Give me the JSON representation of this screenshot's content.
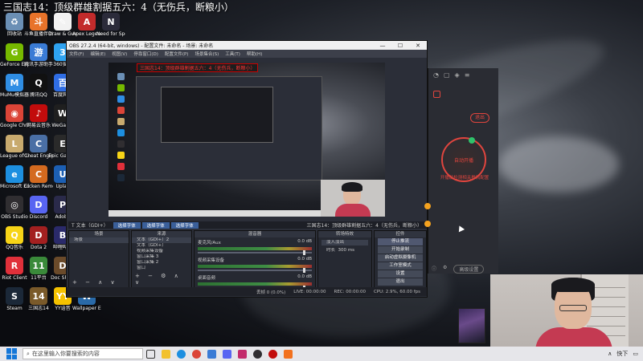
{
  "overlay_title": "三国志14：顶级群雄割据五六：4（无伤兵，断粮小）",
  "desktop_icons": [
    {
      "name": "recycle-bin-icon",
      "label": "回收站",
      "color": "#6b8fb5",
      "glyph": "♻",
      "col": 0,
      "row": 0
    },
    {
      "name": "game-launcher-icon",
      "label": "斗鱼直播伴侣",
      "color": "#e8732a",
      "glyph": "斗",
      "col": 1,
      "row": 0
    },
    {
      "name": "draw-guess-icon",
      "label": "Draw & Guess",
      "color": "#f2f2f2",
      "glyph": "✎",
      "col": 2,
      "row": 0
    },
    {
      "name": "apex-icon",
      "label": "Apex Legends",
      "color": "#c22b2b",
      "glyph": "A",
      "col": 3,
      "row": 0
    },
    {
      "name": "nfs-icon",
      "label": "Need for Speed™",
      "color": "#2b2b3a",
      "glyph": "N",
      "col": 4,
      "row": 0
    },
    {
      "name": "geforce-icon",
      "label": "GeForce Experience",
      "color": "#76b900",
      "glyph": "G",
      "col": 0,
      "row": 1
    },
    {
      "name": "tencent-game-icon",
      "label": "腾讯手游助手",
      "color": "#3a7bd5",
      "glyph": "游",
      "col": 1,
      "row": 1
    },
    {
      "name": "360-icon",
      "label": "360安全",
      "color": "#2ea3f2",
      "glyph": "3",
      "col": 2,
      "row": 1
    },
    {
      "name": "mumu-icon",
      "label": "MuMu模拟器",
      "color": "#2f8de4",
      "glyph": "M",
      "col": 0,
      "row": 2
    },
    {
      "name": "qq-icon",
      "label": "腾讯QQ",
      "color": "#111",
      "glyph": "Q",
      "col": 1,
      "row": 2
    },
    {
      "name": "baidu-icon",
      "label": "百度网盘",
      "color": "#2f6de4",
      "glyph": "百",
      "col": 2,
      "row": 2
    },
    {
      "name": "chrome-icon",
      "label": "Google Chrome",
      "color": "#db4437",
      "glyph": "◉",
      "col": 0,
      "row": 3
    },
    {
      "name": "netease-music-icon",
      "label": "网易云音乐",
      "color": "#c20c0c",
      "glyph": "♪",
      "col": 1,
      "row": 3
    },
    {
      "name": "wegame-icon",
      "label": "WeGame",
      "color": "#1f1f1f",
      "glyph": "W",
      "col": 2,
      "row": 3
    },
    {
      "name": "lol-icon",
      "label": "League of Legends",
      "color": "#c8aa6e",
      "glyph": "L",
      "col": 0,
      "row": 4
    },
    {
      "name": "cheat-engine-icon",
      "label": "Cheat Engine",
      "color": "#4a6fa5",
      "glyph": "C",
      "col": 1,
      "row": 4
    },
    {
      "name": "epic-icon",
      "label": "Epic Games",
      "color": "#2a2a2a",
      "glyph": "E",
      "col": 2,
      "row": 4
    },
    {
      "name": "edge-icon",
      "label": "Microsoft Edge",
      "color": "#1d8fe0",
      "glyph": "e",
      "col": 0,
      "row": 5
    },
    {
      "name": "cicken-icon",
      "label": "Cicken Remote",
      "color": "#d46a1f",
      "glyph": "C",
      "col": 1,
      "row": 5
    },
    {
      "name": "uplay-icon",
      "label": "Uplay",
      "color": "#1c5fb3",
      "glyph": "U",
      "col": 2,
      "row": 5
    },
    {
      "name": "obs-icon",
      "label": "OBS Studio",
      "color": "#302e31",
      "glyph": "◎",
      "col": 0,
      "row": 6
    },
    {
      "name": "discord-icon",
      "label": "Discord",
      "color": "#5865f2",
      "glyph": "D",
      "col": 1,
      "row": 6
    },
    {
      "name": "adobe-icon",
      "label": "Adobe",
      "color": "#2a2a4a",
      "glyph": "P",
      "col": 2,
      "row": 6
    },
    {
      "name": "qq-music-icon",
      "label": "QQ音乐",
      "color": "#f7d417",
      "glyph": "Q",
      "col": 0,
      "row": 7
    },
    {
      "name": "dota2-icon",
      "label": "Dota 2",
      "color": "#a32020",
      "glyph": "D",
      "col": 1,
      "row": 7
    },
    {
      "name": "app-x-icon",
      "label": "哔哩哔哩",
      "color": "#2a2a6a",
      "glyph": "B",
      "col": 2,
      "row": 7
    },
    {
      "name": "riot-icon",
      "label": "Riot Client",
      "color": "#e0303a",
      "glyph": "R",
      "col": 0,
      "row": 8
    },
    {
      "name": "11-icon",
      "label": "11平台",
      "color": "#3a8a3a",
      "glyph": "11",
      "col": 1,
      "row": 8
    },
    {
      "name": "doc-icon",
      "label": "Doc Show",
      "color": "#6a4a2a",
      "glyph": "D",
      "col": 2,
      "row": 8
    },
    {
      "name": "steam-icon",
      "label": "Steam",
      "color": "#1b2838",
      "glyph": "S",
      "col": 0,
      "row": 9
    },
    {
      "name": "sangoku14-icon",
      "label": "三国志14",
      "color": "#7a5a2a",
      "glyph": "14",
      "col": 1,
      "row": 9
    },
    {
      "name": "yy-icon",
      "label": "YY语音",
      "color": "#f5c200",
      "glyph": "YY",
      "col": 2,
      "row": 9
    },
    {
      "name": "wallpaper-icon",
      "label": "Wallpaper Engine",
      "color": "#2a6aa8",
      "glyph": "W",
      "col": 3,
      "row": 9
    }
  ],
  "obs": {
    "title": "OBS 27.2.4 (64-bit, windows) - 配置文件: 未命名 - 场景: 未命名",
    "menu": [
      "文件(F)",
      "编辑(E)",
      "视图(V)",
      "停靠窗口(D)",
      "配置文件(P)",
      "场景集合(S)",
      "工具(T)",
      "帮助(H)"
    ],
    "preview_title": "三国志14：顶级群雄割据五六：4（无伤兵，断粮小）",
    "scene_tabs": [
      "选择字体",
      "选择字体",
      "选择字体"
    ],
    "scene_label": "T 文本（GDI+）",
    "source_label": "三国志14：顶级群雄割据五六：4（无伤兵，断粮小）",
    "docks": {
      "scenes_header": "场景",
      "scenes": [
        "场景"
      ],
      "sources_header": "来源",
      "sources": [
        "文本（GDI+）2",
        "文本（GDI+）",
        "视频采集设备",
        "窗口采集 3",
        "窗口采集 2",
        "窗口"
      ],
      "mixer_header": "混音器",
      "mixer": [
        {
          "name": "麦克风/Aux",
          "db": "0.0 dB"
        },
        {
          "name": "视频采集设备",
          "db": "0.0 dB"
        },
        {
          "name": "桌面音频",
          "db": "0.0 dB"
        }
      ],
      "transition_header": "转场特效",
      "transition_type": "淡入淡出",
      "duration_label": "时长",
      "duration_value": "300 ms",
      "controls_header": "控件",
      "controls": [
        "停止推流",
        "开始录制",
        "启动虚拟摄像机",
        "工作室模式",
        "设置",
        "退出"
      ]
    },
    "status": {
      "drop": "丢帧 0 (0.0%)",
      "live": "LIVE: 00:00:00",
      "rec": "REC: 00:00:00",
      "cpu": "CPU: 2.9%, 60.00 fps"
    }
  },
  "live_app": {
    "logout": "退出",
    "live_button": "自动开播",
    "hint": "开播前检测相关推流配置",
    "settings_button": "高级设置"
  },
  "taskbar": {
    "search_placeholder": "在这里输入你要搜索的内容",
    "tray_text": "快下"
  }
}
